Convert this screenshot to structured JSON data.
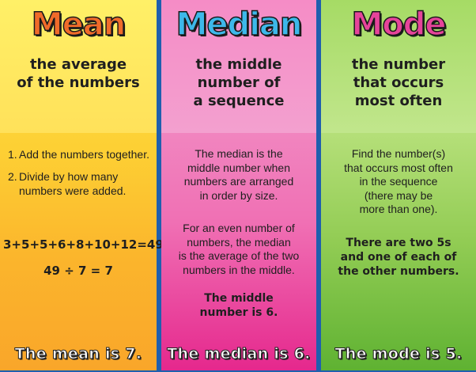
{
  "mean": {
    "title": "Mean",
    "definition": "the average\nof the numbers",
    "steps": [
      {
        "num": "1.",
        "text": "Add the numbers together."
      },
      {
        "num": "2.",
        "text": "Divide by how many numbers were added."
      }
    ],
    "equation": "3+5+5+6+8+10+12=49",
    "division": "49 ÷ 7 = 7",
    "result": "The mean is 7."
  },
  "median": {
    "title": "Median",
    "definition": "the middle\nnumber of\na sequence",
    "para1": "The median is the\nmiddle number when\nnumbers are arranged\nin order by size.",
    "para2": "For an even number of\nnumbers, the median\nis the average of the two\nnumbers in the middle.",
    "note": "The middle\nnumber is 6.",
    "result": "The median is 6."
  },
  "mode": {
    "title": "Mode",
    "definition": "the number\nthat occurs\nmost often",
    "para": "Find the number(s)\nthat occurs most often\nin the sequence\n(there may be\nmore than one).",
    "note": "There are two 5s\nand one of each of\nthe other numbers.",
    "result": "The mode is 5."
  },
  "colors": {
    "mean_title": "#f06b2a",
    "median_title": "#3db8ea",
    "mode_title": "#e6449a",
    "divider": "#1f5fae"
  }
}
